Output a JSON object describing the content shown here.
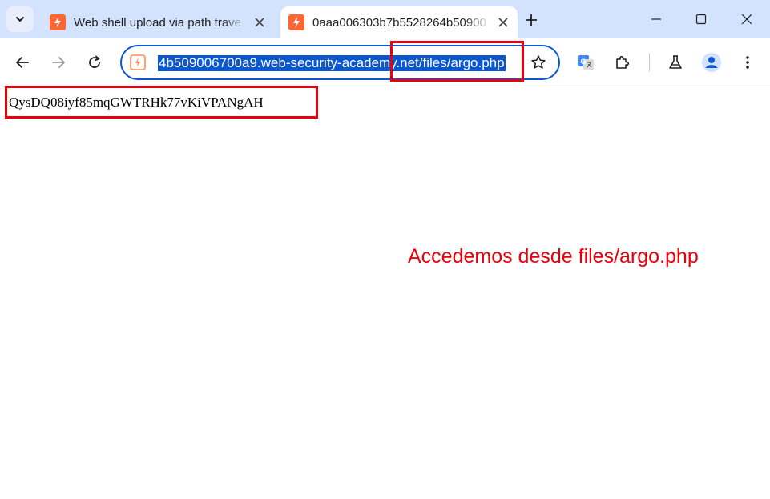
{
  "tabs": [
    {
      "title": "Web shell upload via path trave",
      "active": false,
      "favicon": "portswigger-icon"
    },
    {
      "title": "0aaa006303b7b5528264b50900",
      "active": true,
      "favicon": "portswigger-icon"
    }
  ],
  "omnibox": {
    "url": "4b509006700a9.web-security-academy.net/files/argo.php"
  },
  "page": {
    "content_text": "QysDQ08iyf85mqGWTRHk77vKiVPANgAH"
  },
  "annotation": {
    "text": "Accedemos desde files/argo.php",
    "color": "#e8000b"
  },
  "colors": {
    "tabstrip_bg": "#d3e3fd",
    "accent": "#0b57d0",
    "favicon": "#ff6633",
    "annotation_red": "#e8000b"
  }
}
